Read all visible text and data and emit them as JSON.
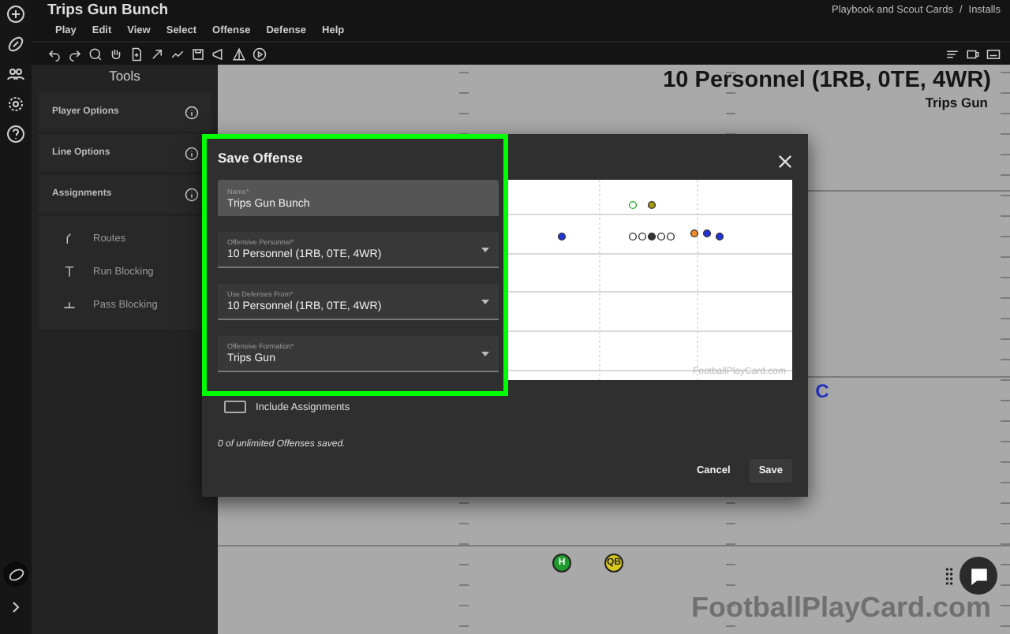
{
  "app": {
    "title": "Trips Gun Bunch",
    "breadcrumb": [
      "Playbook and Scout Cards",
      "Installs"
    ],
    "breadcrumb_separator": "/"
  },
  "menu": [
    "Play",
    "Edit",
    "View",
    "Select",
    "Offense",
    "Defense",
    "Help"
  ],
  "tools": {
    "title": "Tools",
    "sections": [
      {
        "label": "Player Options"
      },
      {
        "label": "Line Options"
      },
      {
        "label": "Assignments"
      }
    ],
    "items": [
      {
        "kind": "routes",
        "label": "Routes"
      },
      {
        "kind": "run",
        "label": "Run Blocking"
      },
      {
        "kind": "pass",
        "label": "Pass Blocking"
      }
    ]
  },
  "field": {
    "title": "10 Personnel (1RB, 0TE, 4WR)",
    "subtitle": "Trips Gun",
    "watermark": "FootballPlayCard.com",
    "players": [
      {
        "kind": "token",
        "label": "H",
        "color": "#1f9a2e"
      },
      {
        "kind": "token",
        "label": "QB",
        "color": "#d9c81c"
      },
      {
        "kind": "letter",
        "label": "C",
        "color": "#2430c8"
      }
    ]
  },
  "dialog": {
    "title": "Save Offense",
    "fields": [
      {
        "kind": "text",
        "label": "Name*",
        "value": "Trips Gun Bunch"
      },
      {
        "kind": "select",
        "label": "Offensive Personnel*",
        "value": "10 Personnel (1RB, 0TE, 4WR)"
      },
      {
        "kind": "select",
        "label": "Use Defenses From*",
        "value": "10 Personnel (1RB, 0TE, 4WR)"
      },
      {
        "kind": "select",
        "label": "Offensive Formation*",
        "value": "Trips Gun"
      }
    ],
    "preview_watermark": "FootballPlayCard.com",
    "include_assignments": {
      "label": "Include Assignments",
      "checked": false
    },
    "note": "0 of unlimited Offenses saved.",
    "buttons": [
      "Cancel",
      "Save"
    ]
  }
}
